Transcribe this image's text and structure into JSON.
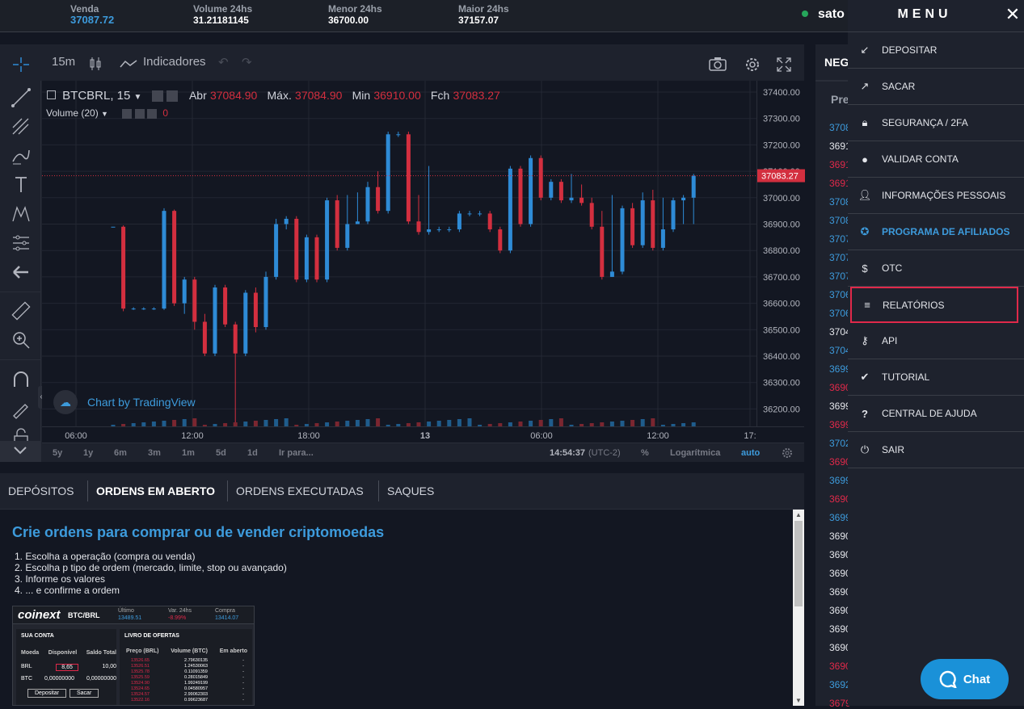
{
  "ticker": {
    "venda_label": "Venda",
    "venda_value": "37087.72",
    "volume_label": "Volume 24hs",
    "volume_value": "31.21181145",
    "menor_label": "Menor 24hs",
    "menor_value": "36700.00",
    "maior_label": "Maior 24hs",
    "maior_value": "37157.07"
  },
  "user": {
    "name": "sato"
  },
  "chart_toolbar": {
    "interval": "15m",
    "indicators": "Indicadores"
  },
  "legend": {
    "symbol": "BTCBRL, 15",
    "abr_label": "Abr",
    "abr_value": "37084.90",
    "max_label": "Máx.",
    "max_value": "37084.90",
    "min_label": "Min",
    "min_value": "36910.00",
    "fch_label": "Fch",
    "fch_value": "37083.27",
    "volume_label": "Volume (20)",
    "volume_value": "0"
  },
  "watermark": "Chart by TradingView",
  "chart_data": {
    "type": "candlestick",
    "y_ticks": [
      "37400.00",
      "37300.00",
      "37200.00",
      "37100.00",
      "37000.00",
      "36900.00",
      "36800.00",
      "36700.00",
      "36600.00",
      "36500.00",
      "36400.00",
      "36300.00",
      "36200.00"
    ],
    "last_price": "37083.27",
    "x_ticks": [
      "06:00",
      "12:00",
      "18:00",
      "13",
      "06:00",
      "12:00",
      "17:"
    ]
  },
  "range_bar": {
    "ranges": [
      "5y",
      "1y",
      "6m",
      "3m",
      "1m",
      "5d",
      "1d",
      "Ir para..."
    ],
    "time": "14:54:37",
    "tz": "(UTC-2)",
    "pct": "%",
    "log": "Logarítmica",
    "auto": "auto"
  },
  "orders": {
    "tabs": [
      "DEPÓSITOS",
      "ORDENS EM ABERTO",
      "ORDENS EXECUTADAS",
      "SAQUES"
    ],
    "heading": "Crie ordens para comprar ou de vender criptomoedas",
    "steps": [
      "1. Escolha a operação (compra ou venda)",
      "2. Escolha p tipo de ordem (mercado, limite, stop ou avançado)",
      "3. Informe os valores",
      "4. ... e confirme a ordem"
    ]
  },
  "screenshot_preview": {
    "logo": "coinext",
    "pair": "BTC/BRL",
    "ultimo_label": "Último",
    "ultimo_value": "13489.51",
    "var_label": "Var. 24hs",
    "var_value": "-8.99%",
    "compra_label": "Compra",
    "compra_value": "13414.07",
    "account_title": "SUA CONTA",
    "account_cols": [
      "Moeda",
      "Disponível",
      "Saldo Total"
    ],
    "account_rows": [
      [
        "BRL",
        "8,65",
        "10,00"
      ],
      [
        "BTC",
        "0,00000000",
        "0,00000000"
      ]
    ],
    "btn_depositar": "Depositar",
    "btn_sacar": "Sacar",
    "book_title": "LIVRO DE OFERTAS",
    "book_cols": [
      "Preço (BRL)",
      "Volume (BTC)",
      "Em aberto"
    ],
    "book_rows": [
      [
        "13526.65",
        "2.79630135",
        "-"
      ],
      [
        "13526.51",
        "1.24530063",
        "-"
      ],
      [
        "13525.78",
        "0.11091359",
        "-"
      ],
      [
        "13525.59",
        "0.28015849",
        "-"
      ],
      [
        "13524.90",
        "1.99249199",
        "-"
      ],
      [
        "13524.65",
        "0.04580957",
        "-"
      ],
      [
        "13524.57",
        "2.99062303",
        "-"
      ],
      [
        "13522.16",
        "0.99623687",
        "-"
      ]
    ]
  },
  "side_panel": {
    "header": "NEG",
    "sub": "Pre",
    "prices": [
      {
        "t": "3708",
        "c": "#3d9bdc"
      },
      {
        "t": "3691",
        "c": "#e3e5ea"
      },
      {
        "t": "3691",
        "c": "#e0294a"
      },
      {
        "t": "3691",
        "c": "#e0294a"
      },
      {
        "t": "3708",
        "c": "#3d9bdc"
      },
      {
        "t": "3708",
        "c": "#3d9bdc"
      },
      {
        "t": "3707",
        "c": "#3d9bdc"
      },
      {
        "t": "3707",
        "c": "#3d9bdc"
      },
      {
        "t": "3707",
        "c": "#3d9bdc"
      },
      {
        "t": "3706",
        "c": "#3d9bdc"
      },
      {
        "t": "3706",
        "c": "#3d9bdc"
      },
      {
        "t": "3704",
        "c": "#e3e5ea"
      },
      {
        "t": "3704",
        "c": "#3d9bdc"
      },
      {
        "t": "3699",
        "c": "#3d9bdc"
      },
      {
        "t": "3690",
        "c": "#e0294a"
      },
      {
        "t": "3699",
        "c": "#e3e5ea"
      },
      {
        "t": "3699",
        "c": "#e0294a"
      },
      {
        "t": "3702",
        "c": "#3d9bdc"
      },
      {
        "t": "3690",
        "c": "#e0294a"
      },
      {
        "t": "3699",
        "c": "#3d9bdc"
      },
      {
        "t": "3690",
        "c": "#e0294a"
      },
      {
        "t": "3699",
        "c": "#3d9bdc"
      },
      {
        "t": "3690",
        "c": "#e3e5ea"
      },
      {
        "t": "3690",
        "c": "#e3e5ea"
      },
      {
        "t": "3690",
        "c": "#e3e5ea"
      },
      {
        "t": "3690",
        "c": "#e3e5ea"
      },
      {
        "t": "3690",
        "c": "#e3e5ea"
      },
      {
        "t": "3690",
        "c": "#e3e5ea"
      },
      {
        "t": "3690",
        "c": "#e3e5ea"
      },
      {
        "t": "3690",
        "c": "#e0294a"
      },
      {
        "t": "3692",
        "c": "#3d9bdc"
      },
      {
        "t": "3679",
        "c": "#e0294a"
      }
    ]
  },
  "menu": {
    "title": "MENU",
    "items": [
      {
        "label": "DEPOSITAR",
        "icon": "arrow-down-left-icon"
      },
      {
        "label": "SACAR",
        "icon": "arrow-up-right-icon"
      },
      {
        "label": "SEGURANÇA / 2FA",
        "icon": "lock-icon"
      },
      {
        "label": "VALIDAR CONTA",
        "icon": "account-circle-icon"
      },
      {
        "label": "INFORMAÇÕES PESSOAIS",
        "icon": "person-icon"
      },
      {
        "label": "PROGRAMA DE AFILIADOS",
        "icon": "star-circle-icon"
      },
      {
        "label": "OTC",
        "icon": "dollar-icon"
      },
      {
        "label": "RELATÓRIOS",
        "icon": "list-icon"
      },
      {
        "label": "API",
        "icon": "key-icon"
      },
      {
        "label": "TUTORIAL",
        "icon": "double-check-icon"
      },
      {
        "label": "CENTRAL DE AJUDA",
        "icon": "help-icon"
      },
      {
        "label": "SAIR",
        "icon": "power-icon"
      }
    ]
  },
  "chat": {
    "label": "Chat"
  },
  "colors": {
    "up": "#2e8bd6",
    "down": "#d32f3f",
    "accent": "#3d9bdc",
    "highlight": "#e0294a"
  }
}
